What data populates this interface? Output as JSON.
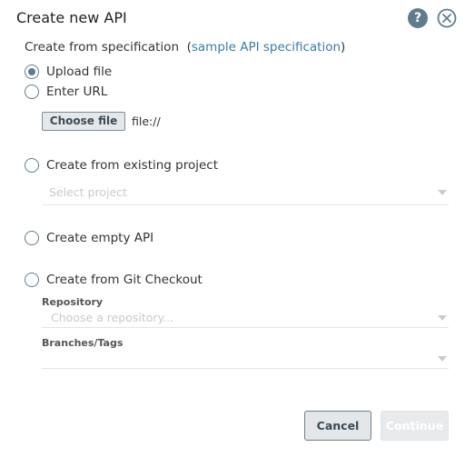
{
  "dialog": {
    "title": "Create new API",
    "help_glyph": "?",
    "icons": [
      "help-icon",
      "close-icon"
    ]
  },
  "spec": {
    "prefix": "Create from specification",
    "link_open": "(",
    "link_text": "sample API specification",
    "link_close": ")"
  },
  "spec_source": {
    "options": [
      "Upload file",
      "Enter URL"
    ],
    "selected": "Upload file",
    "choose_file_label": "Choose file",
    "file_value": "file://"
  },
  "existing_project": {
    "label": "Create from existing project",
    "select_placeholder": "Select project"
  },
  "empty_api": {
    "label": "Create empty API"
  },
  "git_checkout": {
    "label": "Create from Git Checkout",
    "repository_label": "Repository",
    "repository_placeholder": "Choose a repository...",
    "branches_label": "Branches/Tags",
    "branches_value": ""
  },
  "footer": {
    "cancel_label": "Cancel",
    "continue_label": "Continue",
    "continue_enabled": false
  },
  "colors": {
    "accent": "#5f7d8c",
    "link": "#3a7ca5",
    "placeholder": "#c6cbd0"
  }
}
